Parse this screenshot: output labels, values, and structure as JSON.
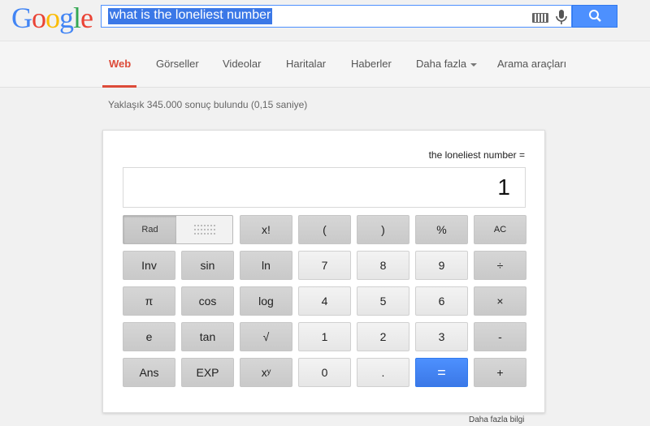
{
  "logo": {
    "letters": [
      "G",
      "o",
      "o",
      "g",
      "l",
      "e"
    ]
  },
  "search": {
    "query": "what is the loneliest number",
    "keyboard_icon": "keyboard-icon",
    "mic_icon": "microphone-icon",
    "button_icon": "search-icon"
  },
  "nav": {
    "tabs": [
      {
        "label": "Web",
        "active": true
      },
      {
        "label": "Görseller"
      },
      {
        "label": "Videolar"
      },
      {
        "label": "Haritalar"
      },
      {
        "label": "Haberler"
      },
      {
        "label": "Daha fazla"
      },
      {
        "label": "Arama araçları"
      }
    ]
  },
  "results": {
    "stats": "Yaklaşık 345.000 sonuç bulundu (0,15 saniye)"
  },
  "calculator": {
    "expression": "the loneliest number =",
    "display": "1",
    "toggle": {
      "rad": "Rad",
      "deg_icon": "dotted-grid-icon"
    },
    "buttons": {
      "fact": "x!",
      "lparen": "(",
      "rparen": ")",
      "percent": "%",
      "ac": "AC",
      "inv": "Inv",
      "sin": "sin",
      "ln": "ln",
      "seven": "7",
      "eight": "8",
      "nine": "9",
      "divide": "÷",
      "pi": "π",
      "cos": "cos",
      "log": "log",
      "four": "4",
      "five": "5",
      "six": "6",
      "multiply": "×",
      "e": "e",
      "tan": "tan",
      "sqrt": "√",
      "one": "1",
      "two": "2",
      "three": "3",
      "minus": "-",
      "ans": "Ans",
      "exp": "EXP",
      "power": "xʸ",
      "zero": "0",
      "dot": ".",
      "equals": "=",
      "plus": "+"
    }
  },
  "footer": {
    "more_info": "Daha fazla bilgi"
  },
  "colors": {
    "accent_red": "#dd4b39",
    "accent_blue": "#4d90fe"
  }
}
